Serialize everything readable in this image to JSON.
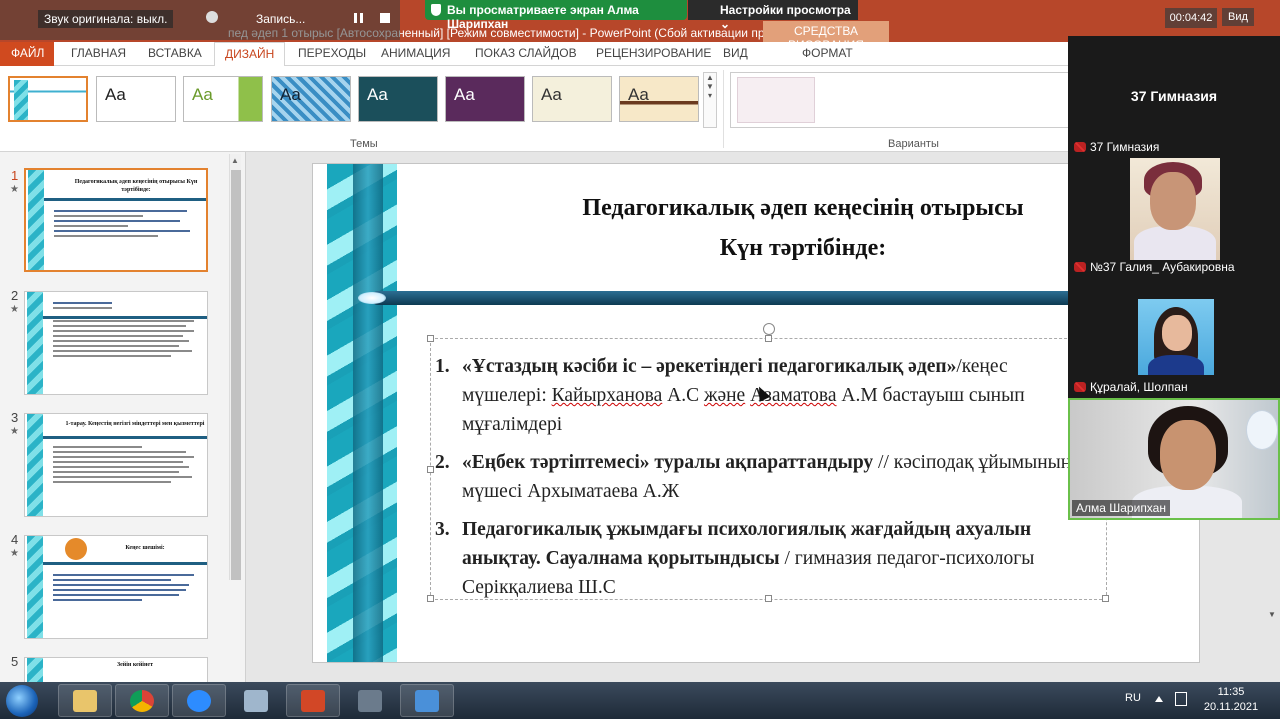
{
  "zoom": {
    "audio_label": "Звук оригинала: выкл.",
    "record_label": "Запись...",
    "share_banner": "Вы просматриваете экран Алма Шарипхан",
    "view_settings": "Настройки просмотра",
    "timer": "00:04:42",
    "view_button": "Вид"
  },
  "powerpoint": {
    "title": "пед әдеп 1 отырыс [Автосохраненный] [Режим совместимости] - PowerPoint (Сбой активации пр...",
    "contextual_tab": "СРЕДСТВА РИСОВАНИЯ",
    "tabs": [
      "ФАЙЛ",
      "ГЛАВНАЯ",
      "ВСТАВКА",
      "ДИЗАЙН",
      "ПЕРЕХОДЫ",
      "АНИМАЦИЯ",
      "ПОКАЗ СЛАЙДОВ",
      "РЕЦЕНЗИРОВАНИЕ",
      "ВИД",
      "ФОРМАТ"
    ],
    "themes_label": "Темы",
    "variants_label": "Варианты",
    "theme_sample": "Aa",
    "theme_colors": [
      "#ffffff",
      "#ffffff",
      "#8fc04a",
      "#3a8ec4",
      "#1b4f5b",
      "#5a2a5c",
      "#f4f0dc",
      "#f7e8c8"
    ]
  },
  "thumbnails": [
    {
      "num": "1",
      "star": "★",
      "title": "Педагогикалық әдеп кеңесінің отырысы Күн тәртібінде:"
    },
    {
      "num": "2",
      "star": "★",
      "title": "Педагогикалық кеңес"
    },
    {
      "num": "3",
      "star": "★",
      "title": "1-тарау. Кеңестің негізгі міндеттері мен қызметтері"
    },
    {
      "num": "4",
      "star": "★",
      "title": "Кеңес шешімі:"
    },
    {
      "num": "5",
      "star": "",
      "title": "Зейін кейінет"
    }
  ],
  "slide": {
    "title_line1": "Педагогикалық әдеп кеңесінің отырысы",
    "title_line2": "Күн тәртібінде:",
    "items": [
      {
        "num": "1.",
        "bold": "«Ұстаздың кәсіби  іс – әрекетіндегі педагогикалық әдеп»",
        "rest_a": "/кеңес мүшелері: ",
        "name1": "Кайырханова",
        "rest_b": " А.С ",
        "and": "және",
        "rest_c": " ",
        "name2": "Азаматова",
        "rest_d": "  А.М бастауыш сынып мұғалімдері"
      },
      {
        "num": "2.",
        "bold": "«Еңбек тәртіптемесі» туралы ақпараттандыру",
        "rest": " // кәсіподақ ұйымының мүшесі Архыматаева А.Ж"
      },
      {
        "num": "3.",
        "bold": " Педагогикалық ұжымдағы психологиялық жағдайдың ахуалын анықтау. Сауалнама қорытындысы",
        "rest": " / гимназия педагог-психологы Серікқалиева Ш.С"
      }
    ]
  },
  "participants": {
    "host_label": "37 Гимназия",
    "tiles": [
      {
        "name": "37 Гимназия"
      },
      {
        "name": "№37  Галия_ Аубакировна"
      },
      {
        "name": "Құралай, Шолпан"
      },
      {
        "name": "Алма Шарипхан"
      }
    ]
  },
  "taskbar": {
    "lang": "RU",
    "time": "11:35",
    "date": "20.11.2021"
  }
}
